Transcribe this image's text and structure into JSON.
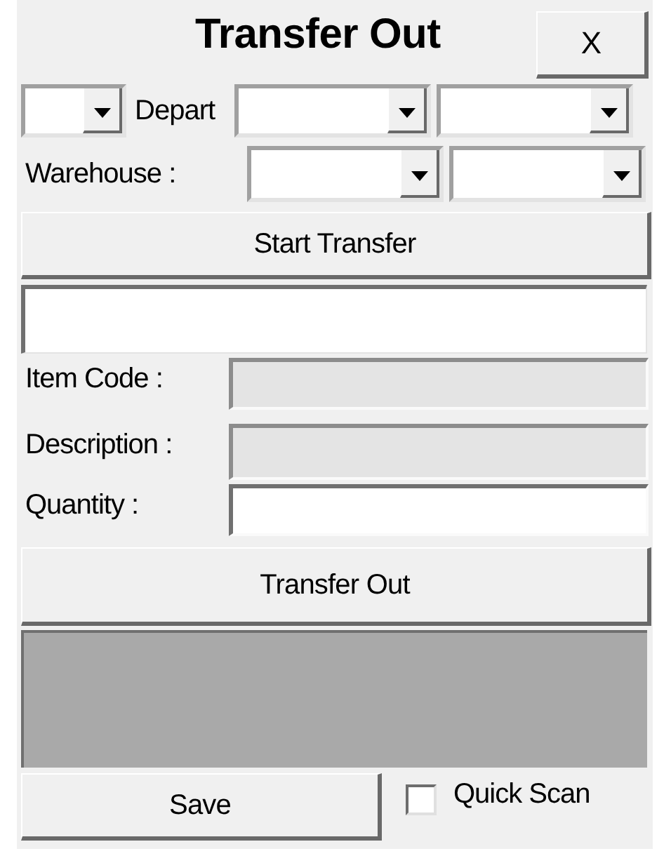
{
  "title": "Transfer Out",
  "close_button": "X",
  "depart_label": "Depart",
  "warehouse_label": "Warehouse :",
  "start_button": "Start Transfer",
  "fields": [
    {
      "label": "Item Code :",
      "disabled": true
    },
    {
      "label": "Description :",
      "disabled": true
    },
    {
      "label": "Quantity :",
      "disabled": false
    }
  ],
  "transfer_button": "Transfer Out",
  "save_button": "Save",
  "quick_scan": {
    "label": "Quick Scan",
    "checked": false
  }
}
